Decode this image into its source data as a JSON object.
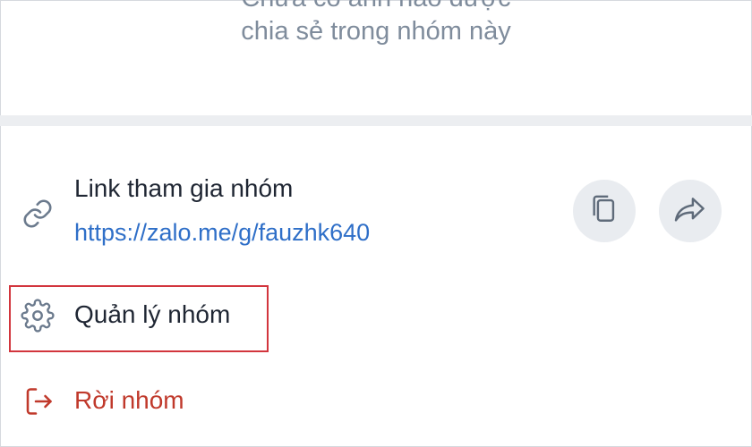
{
  "empty_state": {
    "line1": "Chưa có ảnh nào được",
    "line2": "chia sẻ trong nhóm này"
  },
  "group_link": {
    "title": "Link tham gia nhóm",
    "url": "https://zalo.me/g/fauzhk640",
    "icon": "link-icon",
    "actions": [
      {
        "name": "copy",
        "icon": "copy-icon"
      },
      {
        "name": "share",
        "icon": "share-icon"
      }
    ]
  },
  "manage_group": {
    "label": "Quản lý nhóm",
    "icon": "gear-icon",
    "highlight_color": "#d2353d"
  },
  "leave_group": {
    "label": "Rời nhóm",
    "icon": "exit-icon",
    "color": "#c0392b"
  },
  "colors": {
    "link": "#2f6fc8",
    "text": "#1f2633",
    "muted": "#7f8c9c",
    "button_bg": "#e9ecf0"
  }
}
